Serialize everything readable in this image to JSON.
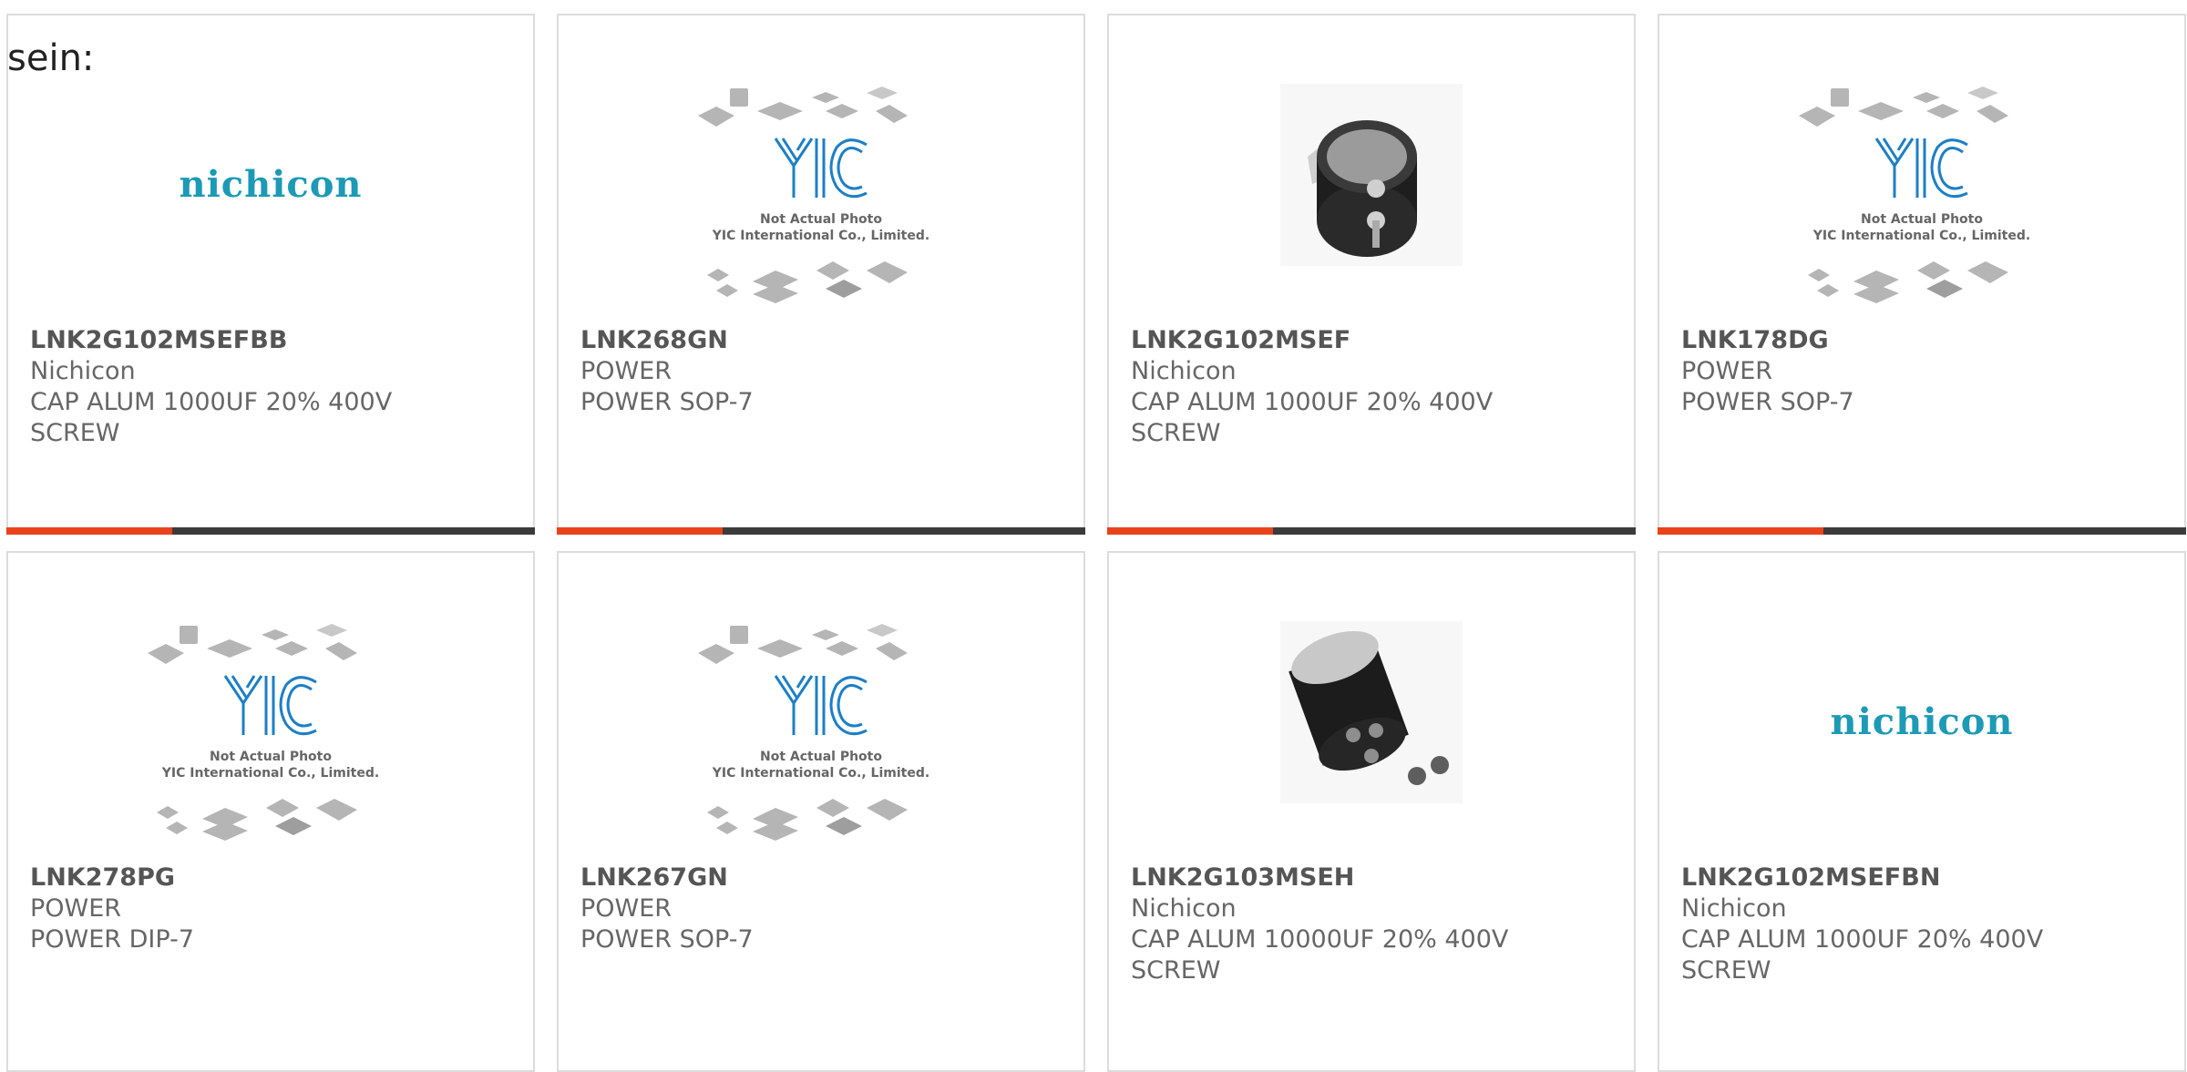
{
  "intro_text": "sein:",
  "colors": {
    "accent": "#e8431b",
    "bar": "#3b3b3b",
    "border": "#dcdcdc",
    "nichicon": "#1c9ab6",
    "yic_blue": "#1d7fc6"
  },
  "placeholder": {
    "line1": "Not Actual Photo",
    "line2": "YIC International Co., Limited."
  },
  "nichicon_logo_text": "nichicon",
  "products": [
    {
      "part": "LNK2G102MSEFBB",
      "brand": "Nichicon",
      "desc": "CAP ALUM 1000UF 20% 400V",
      "desc2": "SCREW",
      "image": "nichicon-logo"
    },
    {
      "part": "LNK268GN",
      "brand": "POWER",
      "desc": "POWER SOP-7",
      "desc2": "",
      "image": "yic-placeholder"
    },
    {
      "part": "LNK2G102MSEF",
      "brand": "Nichicon",
      "desc": "CAP ALUM 1000UF 20% 400V",
      "desc2": "SCREW",
      "image": "capacitor-photo"
    },
    {
      "part": "LNK178DG",
      "brand": "POWER",
      "desc": "POWER SOP-7",
      "desc2": "",
      "image": "yic-placeholder"
    },
    {
      "part": "LNK278PG",
      "brand": "POWER",
      "desc": "POWER DIP-7",
      "desc2": "",
      "image": "yic-placeholder"
    },
    {
      "part": "LNK267GN",
      "brand": "POWER",
      "desc": "POWER SOP-7",
      "desc2": "",
      "image": "yic-placeholder"
    },
    {
      "part": "LNK2G103MSEH",
      "brand": "Nichicon",
      "desc": "CAP ALUM 10000UF 20% 400V",
      "desc2": "SCREW",
      "image": "capacitor-photo"
    },
    {
      "part": "LNK2G102MSEFBN",
      "brand": "Nichicon",
      "desc": "CAP ALUM 1000UF 20% 400V",
      "desc2": "SCREW",
      "image": "nichicon-logo"
    }
  ]
}
